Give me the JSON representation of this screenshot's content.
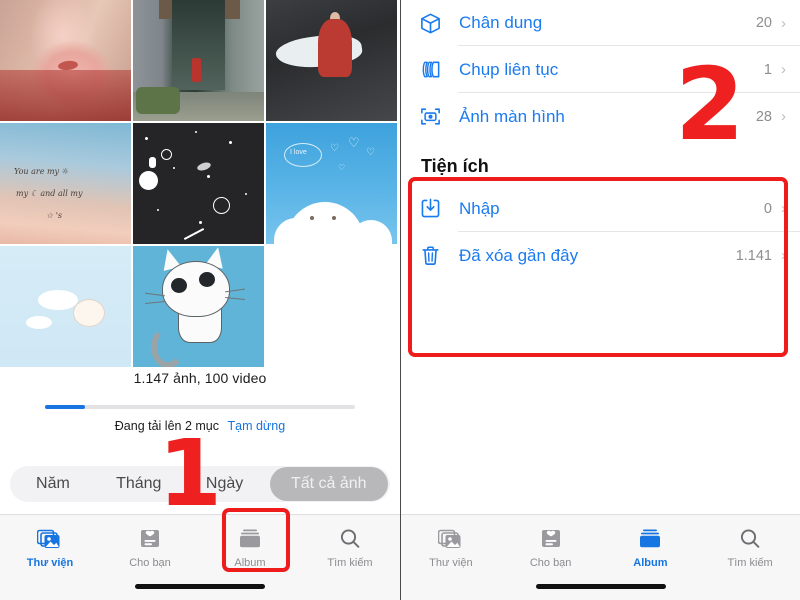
{
  "left_panel": {
    "photo_grid": {
      "cells": [
        {
          "name": "photo-portrait-girl",
          "alt": "portrait of girl in red"
        },
        {
          "name": "photo-stone-corridor",
          "alt": "stone pillars corridor"
        },
        {
          "name": "photo-red-dress-rocks",
          "alt": "woman in red dress on rocks"
        },
        {
          "name": "photo-sky-quote",
          "alt": "pastel sky with handwriting"
        },
        {
          "name": "photo-space-dark",
          "alt": "dark space doodle wallpaper"
        },
        {
          "name": "photo-cloud-love",
          "alt": "cute cloud with hearts"
        },
        {
          "name": "photo-bunny-sky",
          "alt": "bunny on clouds"
        },
        {
          "name": "photo-cat-illustration",
          "alt": "grey cat illustration"
        }
      ],
      "quote_lines": [
        "You are my ☼",
        "my ☾ and all my",
        "☆ 's"
      ]
    },
    "library_summary": "1.147 ảnh, 100 video",
    "upload_status": "Đang tải lên 2 mục",
    "pause_label": "Tạm dừng",
    "progress_percent": 13,
    "segmented": {
      "options": [
        "Năm",
        "Tháng",
        "Ngày",
        "Tất cả ảnh"
      ],
      "selected": "Tất cả ảnh"
    },
    "tabbar": {
      "tabs": [
        {
          "label": "Thư viện",
          "icon": "photos-icon",
          "active": true
        },
        {
          "label": "Cho bạn",
          "icon": "for-you-icon",
          "active": false
        },
        {
          "label": "Album",
          "icon": "albums-icon",
          "active": false
        },
        {
          "label": "Tìm kiếm",
          "icon": "search-icon",
          "active": false
        }
      ]
    }
  },
  "right_panel": {
    "album_rows": [
      {
        "label": "Chân dung",
        "count": "20",
        "icon": "cube-icon",
        "chevron": "›"
      },
      {
        "label": "Chụp liên tục",
        "count": "1",
        "icon": "burst-layers-icon",
        "chevron": "›"
      },
      {
        "label": "Ảnh màn hình",
        "count": "28",
        "icon": "screenshot-camera-icon",
        "chevron": "›"
      }
    ],
    "utilities_title": "Tiện ích",
    "utility_rows": [
      {
        "label": "Nhập",
        "count": "0",
        "icon": "import-tray-icon",
        "chevron": "›"
      },
      {
        "label": "Đã xóa gần đây",
        "count": "1.141",
        "icon": "trash-icon",
        "chevron": "›"
      }
    ],
    "tabbar": {
      "tabs": [
        {
          "label": "Thư viện",
          "icon": "photos-icon",
          "active": false
        },
        {
          "label": "Cho bạn",
          "icon": "for-you-icon",
          "active": false
        },
        {
          "label": "Album",
          "icon": "albums-icon",
          "active": true
        },
        {
          "label": "Tìm kiếm",
          "icon": "search-icon",
          "active": false
        }
      ]
    }
  },
  "annotations": {
    "step_one": "1",
    "step_two": "2",
    "highlight_color": "#EF1C1C"
  },
  "colors": {
    "accent_blue": "#1675E0",
    "link_blue": "#1A7BF0",
    "annotation_red": "#EF1C1C",
    "secondary_text": "#8D8D92"
  }
}
